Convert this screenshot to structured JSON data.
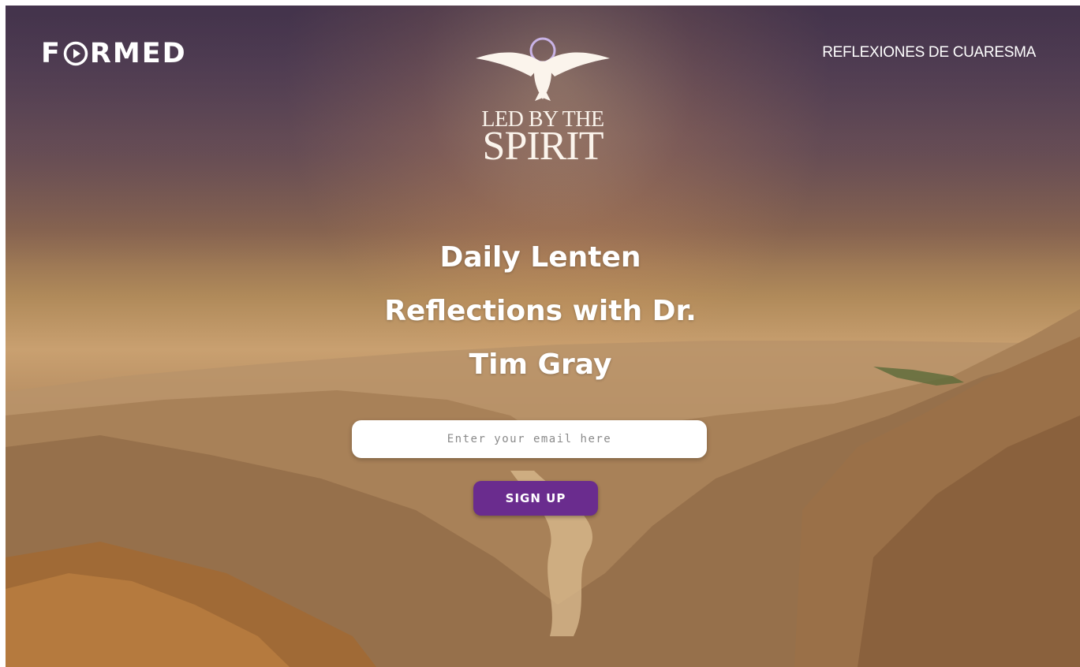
{
  "header": {
    "logo_text": "F RMED",
    "logo_icon": "play-circle-icon",
    "nav_link_label": "REFLEXIONES DE CUARESMA"
  },
  "emblem": {
    "icon": "dove-with-halo-icon",
    "line1": "LED BY THE",
    "line2": "SPIRIT"
  },
  "hero": {
    "headline_lines": [
      "Daily Lenten",
      "Reflections with Dr.",
      "Tim Gray"
    ]
  },
  "signup": {
    "email_placeholder": "Enter your email here",
    "email_value": "",
    "button_label": "SIGN UP"
  },
  "colors": {
    "accent": "#6a2c8e",
    "text_light": "#ffffff",
    "emblem_text": "#fbf4ec"
  }
}
